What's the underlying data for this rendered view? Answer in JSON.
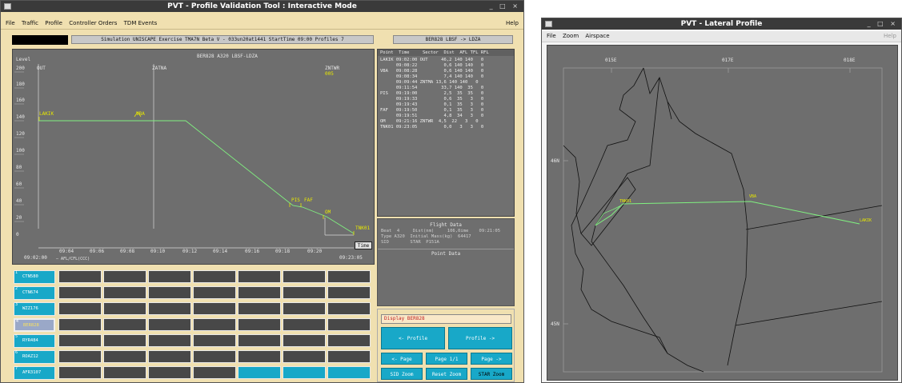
{
  "left_window": {
    "title": "PVT - Profile Validation Tool : Interactive Mode",
    "controls": "_ □ ×",
    "menu": [
      "File",
      "Traffic",
      "Profile",
      "Controller Orders",
      "TDM Events"
    ],
    "help": "Help",
    "simulation_bar": "Simulation UNISCAPE Exercise TMA7N Beta V - 033un20at1441 StartTime 09:00 Profiles 7",
    "flight_route": "BER828  LBSF -> LDZA",
    "profile_header": "BER828   A320 LBSF-LDZA",
    "level_label": "Level",
    "sector_labels": [
      "OUT",
      "ZATNA",
      "ZNTWR"
    ],
    "sector_sub": "005",
    "y_ticks": [
      "200",
      "180",
      "160",
      "140",
      "120",
      "100",
      "80",
      "60",
      "40",
      "20",
      "0"
    ],
    "x_ticks": [
      "09:04",
      "09:06",
      "09:08",
      "09:10",
      "09:12",
      "09:14",
      "09:16",
      "09:18",
      "09:20"
    ],
    "x_start": "09:02:00",
    "x_end": "09:23:05",
    "afl_legend": "— AFL/CFL(CCC)",
    "time_button": "Time",
    "waypoint_labels": [
      "LAKIK",
      "VBA",
      "PIS",
      "FAF",
      "OM",
      "TNK01"
    ],
    "table": {
      "headers": "Point  Time     Sector  Dist  AFL TFL RFL",
      "rows": [
        "LAKIK 09:02:00 OUT     46,2 140 140   0",
        "      09:08:22          0,6 140 140   0",
        "VBA   09:08:28          0,6 140 140   0",
        "      09:08:34          7,4 140 140   0",
        "      09:09:44 ZNTMA 13,6 140 140   0",
        "      09:11:54         33,7 140  35   0",
        "PIS   09:19:00          2,5  35  35   0",
        "      09:19:33          0,6  35   3   0",
        "      09:19:43          0,1  35   3   0",
        "FAF   09:19:50          0,1  35   3   0",
        "      09:19:51          4,8  34   3   0",
        "OM    09:21:16 ZNTWR  4,5  22   3   0",
        "TNK01 09:23:05          0,0   3   3   0"
      ]
    },
    "flight_data": {
      "title": "Flight Data",
      "lines": [
        "Beat  4     Dist(nm)     106,0ime    09:21:05",
        "Type A320  Initial Mass(kg)  64417",
        "SID        STAR  P151A"
      ]
    },
    "point_data_title": "Point Data",
    "flights": [
      {
        "num": "1",
        "label": "CTN580"
      },
      {
        "num": "2",
        "label": "CTN674"
      },
      {
        "num": "3",
        "label": "WZZ176"
      },
      {
        "num": "4",
        "label": "BER828"
      },
      {
        "num": "5",
        "label": "RYR484"
      },
      {
        "num": "6",
        "label": "ROAZ12"
      },
      {
        "num": "7",
        "label": "AFR3107"
      }
    ],
    "display_field": "Display BER828",
    "buttons": {
      "prev_profile": "<- Profile",
      "next_profile": "Profile ->",
      "prev_page": "<- Page",
      "page": "Page 1/1",
      "next_page": "Page ->",
      "sid_zoom": "SID Zoom",
      "reset_zoom": "Reset Zoom",
      "star_zoom": "STAR Zoom"
    },
    "colors": {
      "cyan": "#18a8c8",
      "profile_line": "#80f080",
      "waypoint": "#e8e800"
    }
  },
  "right_window": {
    "title": "PVT - Lateral Profile",
    "controls": "_ □ ×",
    "menu": [
      "File",
      "Zoom",
      "Airspace"
    ],
    "help": "Help",
    "lon_ticks": [
      "015E",
      "017E",
      "018E"
    ],
    "lat_ticks": [
      "46N",
      "45N"
    ],
    "route_labels": [
      "TNK01",
      "VBA",
      "LAKIK"
    ]
  }
}
